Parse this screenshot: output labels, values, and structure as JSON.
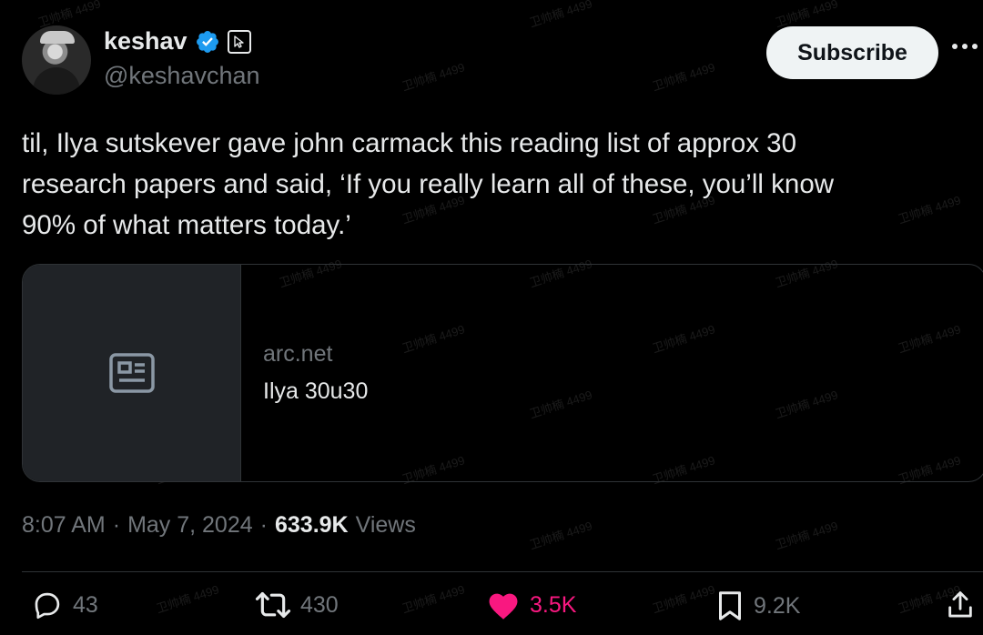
{
  "author": {
    "display_name": "keshav",
    "handle": "@keshavchan",
    "verified": true,
    "badge_color": "#1d9bf0"
  },
  "subscribe_label": "Subscribe",
  "tweet": {
    "text": "til, Ilya sutskever gave john carmack this reading list of approx 30\nresearch papers and said, ‘If you really learn all of these, you’ll know\n90% of what matters today.’"
  },
  "card": {
    "icon": "article-icon",
    "domain": "arc.net",
    "title": "Ilya 30u30"
  },
  "meta": {
    "time": "8:07 AM",
    "sep1": "·",
    "date": "May 7, 2024",
    "sep2": "·",
    "views_count": "633.9K",
    "views_label": "Views"
  },
  "actions": {
    "replies": "43",
    "retweets": "430",
    "likes": "3.5K",
    "bookmarks": "9.2K",
    "like_color": "#f91880"
  },
  "watermark_text": "卫帅楠 4499"
}
